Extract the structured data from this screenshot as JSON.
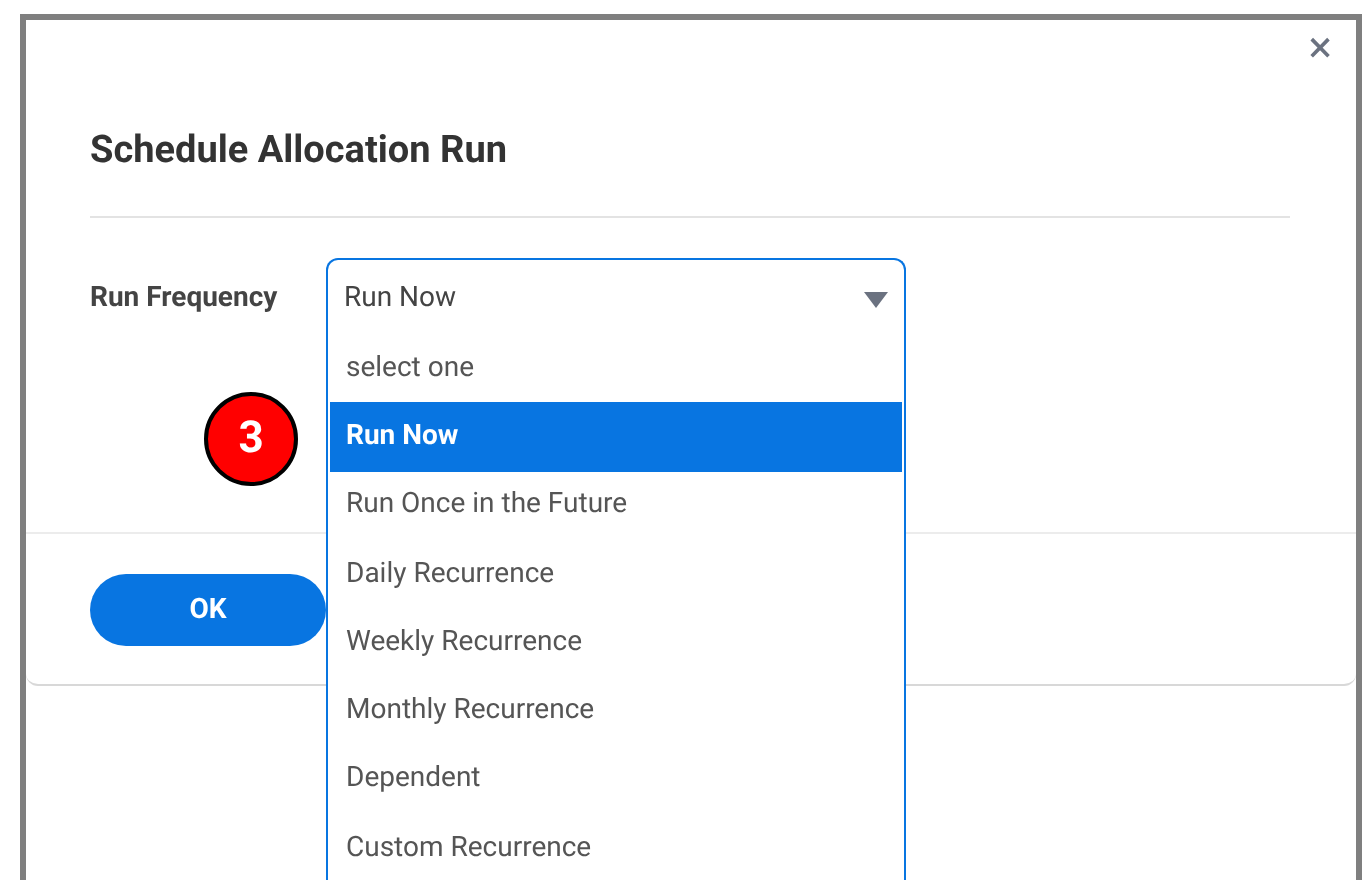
{
  "dialog": {
    "title": "Schedule Allocation Run",
    "close": "×"
  },
  "field": {
    "label": "Run Frequency",
    "value": "Run Now",
    "expanded": true
  },
  "options": [
    {
      "label": "select one",
      "selected": false
    },
    {
      "label": "Run Now",
      "selected": true
    },
    {
      "label": "Run Once in the Future",
      "selected": false
    },
    {
      "label": "Daily Recurrence",
      "selected": false
    },
    {
      "label": "Weekly Recurrence",
      "selected": false
    },
    {
      "label": "Monthly Recurrence",
      "selected": false
    },
    {
      "label": "Dependent",
      "selected": false
    },
    {
      "label": "Custom Recurrence",
      "selected": false
    }
  ],
  "step_badge": "3",
  "buttons": [
    "OK"
  ]
}
